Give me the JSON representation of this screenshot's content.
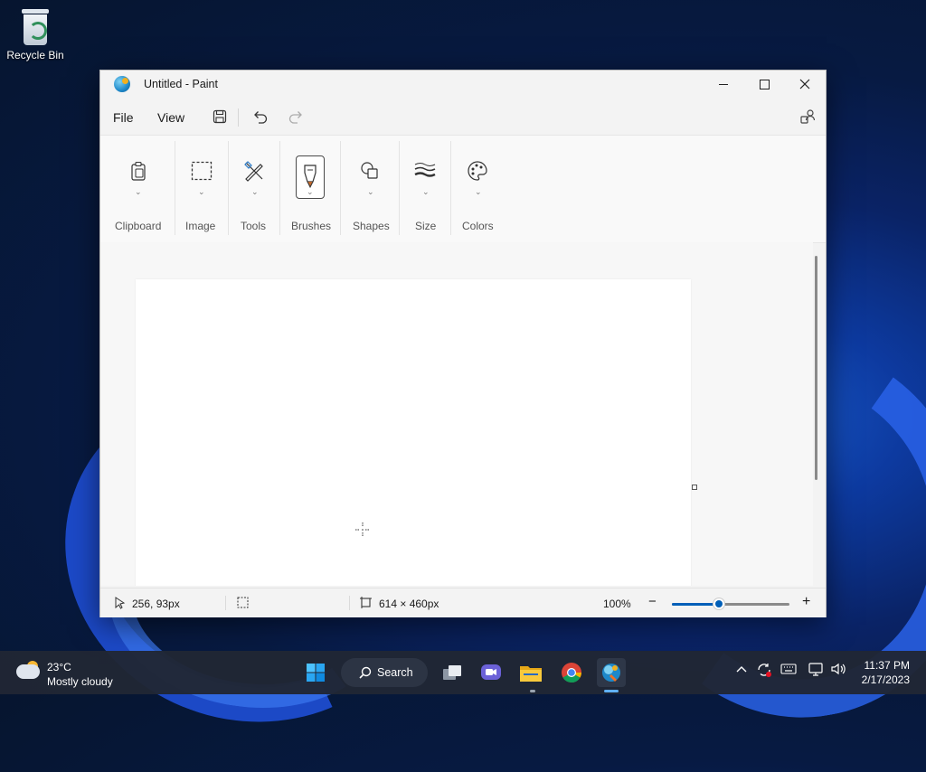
{
  "desktop": {
    "icons": [
      {
        "label": "Recycle Bin",
        "icon": "recycle-bin-icon"
      }
    ]
  },
  "window": {
    "title": "Untitled - Paint",
    "icon": "paint-app-icon",
    "controls": {
      "minimize": "minimize-icon",
      "maximize": "maximize-icon",
      "close": "close-icon"
    }
  },
  "menubar": {
    "file": "File",
    "view": "View",
    "actions": [
      "save-icon",
      "undo-icon",
      "redo-icon"
    ],
    "right_icon": "account-icon"
  },
  "ribbon": {
    "groups": [
      {
        "label": "Clipboard",
        "icon": "clipboard-icon"
      },
      {
        "label": "Image",
        "icon": "selection-icon"
      },
      {
        "label": "Tools",
        "icon": "tools-icon"
      },
      {
        "label": "Brushes",
        "icon": "brush-icon",
        "selected": true
      },
      {
        "label": "Shapes",
        "icon": "shapes-icon"
      },
      {
        "label": "Size",
        "icon": "size-icon"
      },
      {
        "label": "Colors",
        "icon": "palette-icon"
      }
    ]
  },
  "status": {
    "cursor_pos": "256, 93px",
    "canvas_size": "614 × 460px",
    "zoom": "100%",
    "zoom_value": 0.4,
    "zoom_minus": "−",
    "zoom_plus": "+"
  },
  "taskbar": {
    "weather": {
      "temp": "23°C",
      "desc": "Mostly cloudy"
    },
    "search_label": "Search",
    "apps": [
      "start-icon",
      "task-view-icon",
      "chat-icon",
      "file-explorer-icon",
      "chrome-icon",
      "paint-icon"
    ],
    "tray_icons": [
      "chevron-up-icon",
      "sync-icon",
      "keyboard-icon",
      "network-icon",
      "volume-icon"
    ],
    "time": "11:37 PM",
    "date": "2/17/2023"
  },
  "colors": {
    "accent": "#005fb8",
    "window_bg": "#f3f3f3",
    "taskbar_bg": "#202634"
  }
}
